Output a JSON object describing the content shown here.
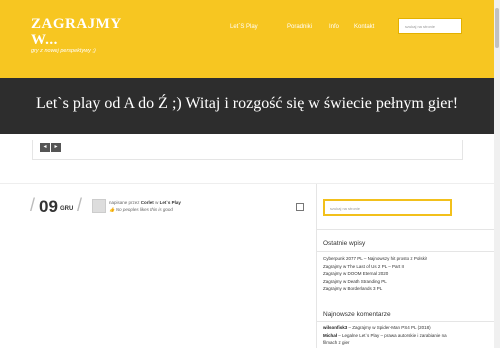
{
  "header": {
    "logo": "ZAGRAJMY W...",
    "tagline": "gry z nowej perspektywy ;)",
    "nav": [
      "Let`S Play",
      "Poradniki",
      "Info",
      "Kontakt"
    ],
    "search_placeholder": "szukaj na stronie"
  },
  "banner": {
    "title": "Let`s play od A do Ź ;) Witaj i rozgość się w świecie pełnym gier!"
  },
  "slider": {
    "prev": "◂",
    "next": "▸"
  },
  "post": {
    "slash": "/",
    "day": "09",
    "month": "GRU",
    "meta_prefix": "napisane przez",
    "author": "Corlet",
    "meta_in": "w",
    "category": "Let`s Play",
    "likes": "No peoples likes this is good"
  },
  "sidebar": {
    "search_placeholder": "szukaj na stronie",
    "recent_title": "Ostatnie wpisy",
    "recent": [
      "Cyberpunk 2077 PL – Najnowszy hit prosto z Polski!",
      "Zagrajmy w The Last of Us 2 PL – Part II",
      "Zagrajmy w DOOM Eternal 2020",
      "Zagrajmy w Death Stranding PL",
      "Zagrajmy w Borderlands 3 PL"
    ],
    "comments_title": "Najnowsze komentarze",
    "comments": [
      {
        "author": "wilsonfisk3",
        "text": "– Zagrajmy w Spider-Man PS4 PL (2018)"
      },
      {
        "author": "Michał",
        "text": "– Legalne Let`s Play – prawa autorskie i zarabianie na"
      },
      {
        "author": "",
        "text": "filmach z gier"
      }
    ]
  }
}
